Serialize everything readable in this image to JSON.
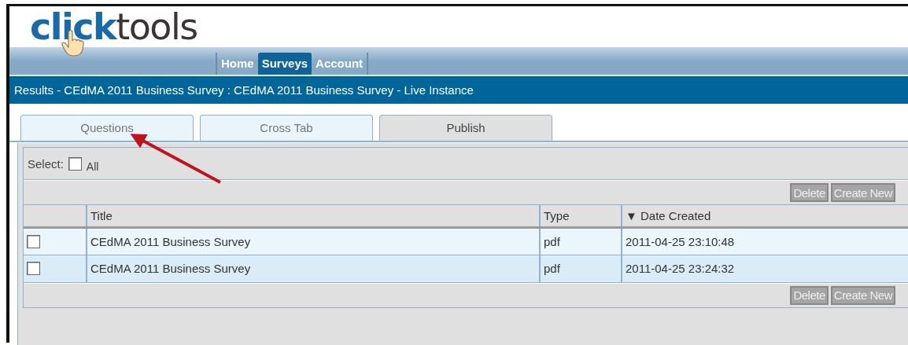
{
  "logo": {
    "accent": "click",
    "rest": "tools"
  },
  "nav_tabs": [
    {
      "label": "Home",
      "selected": false
    },
    {
      "label": "Surveys",
      "selected": true
    },
    {
      "label": "Account",
      "selected": false
    }
  ],
  "page_title": "Results - CEdMA 2011 Business Survey : CEdMA 2011 Business Survey - Live Instance",
  "sub_tabs": [
    {
      "label": "Questions",
      "selected": false
    },
    {
      "label": "Cross Tab",
      "selected": false
    },
    {
      "label": "Publish",
      "selected": true
    }
  ],
  "select_all": {
    "label": "Select:",
    "option": "All",
    "checked": false
  },
  "toolbar_buttons": [
    "Delete",
    "Create New"
  ],
  "table": {
    "columns": [
      "Title",
      "Type",
      "▼ Date Created"
    ],
    "rows": [
      {
        "checked": false,
        "cells": [
          "CEdMA 2011 Business Survey",
          "pdf",
          "2011-04-25 23:10:48"
        ]
      },
      {
        "checked": false,
        "cells": [
          "CEdMA 2011 Business Survey",
          "pdf",
          "2011-04-25 23:24:32"
        ]
      }
    ]
  },
  "footer_buttons": [
    "Delete",
    "Create New"
  ]
}
